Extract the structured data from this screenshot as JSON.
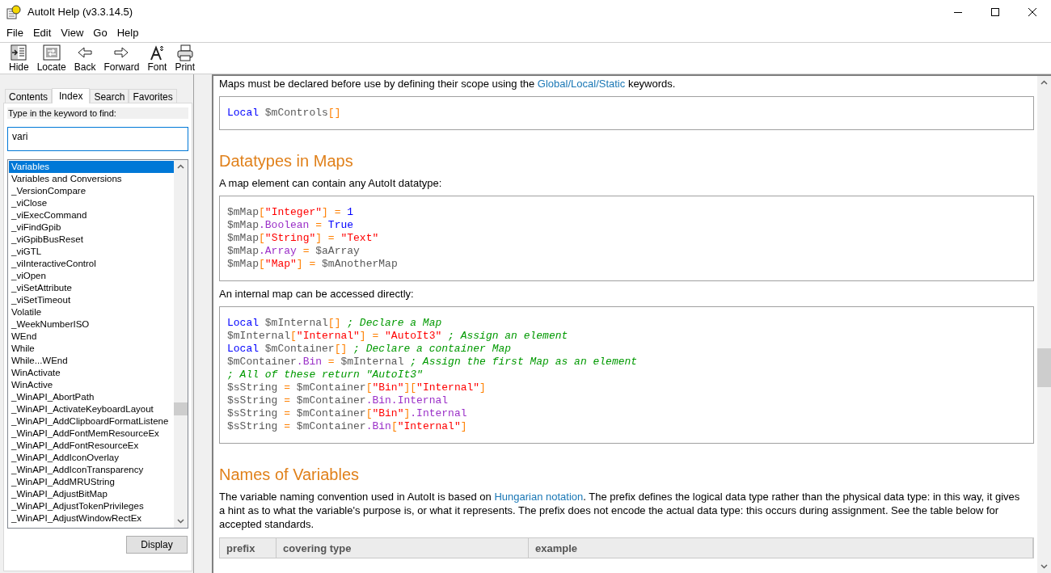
{
  "window": {
    "title": "AutoIt Help (v3.3.14.5)"
  },
  "menu": [
    "File",
    "Edit",
    "View",
    "Go",
    "Help"
  ],
  "toolbar": [
    {
      "label": "Hide",
      "kind": "hide"
    },
    {
      "label": "Locate",
      "kind": "locate"
    },
    {
      "label": "Back",
      "kind": "back"
    },
    {
      "label": "Forward",
      "kind": "forward"
    },
    {
      "label": "Font",
      "kind": "font"
    },
    {
      "label": "Print",
      "kind": "print"
    }
  ],
  "nav": {
    "tabs": [
      {
        "label": "Contents",
        "selected": false
      },
      {
        "label": "Index",
        "selected": true
      },
      {
        "label": "Search",
        "selected": false
      },
      {
        "label": "Favorites",
        "selected": false
      }
    ],
    "prompt": "Type in the keyword to find:",
    "keyword": "vari",
    "items": [
      {
        "label": "Variables",
        "selected": true
      },
      {
        "label": "Variables and Conversions",
        "selected": false
      },
      {
        "label": "_VersionCompare",
        "selected": false
      },
      {
        "label": "_viClose",
        "selected": false
      },
      {
        "label": "_viExecCommand",
        "selected": false
      },
      {
        "label": "_viFindGpib",
        "selected": false
      },
      {
        "label": "_viGpibBusReset",
        "selected": false
      },
      {
        "label": "_viGTL",
        "selected": false
      },
      {
        "label": "_viInteractiveControl",
        "selected": false
      },
      {
        "label": "_viOpen",
        "selected": false
      },
      {
        "label": "_viSetAttribute",
        "selected": false
      },
      {
        "label": "_viSetTimeout",
        "selected": false
      },
      {
        "label": "Volatile",
        "selected": false
      },
      {
        "label": "_WeekNumberISO",
        "selected": false
      },
      {
        "label": "WEnd",
        "selected": false
      },
      {
        "label": "While",
        "selected": false
      },
      {
        "label": "While...WEnd",
        "selected": false
      },
      {
        "label": "WinActivate",
        "selected": false
      },
      {
        "label": "WinActive",
        "selected": false
      },
      {
        "label": "_WinAPI_AbortPath",
        "selected": false
      },
      {
        "label": "_WinAPI_ActivateKeyboardLayout",
        "selected": false
      },
      {
        "label": "_WinAPI_AddClipboardFormatListene",
        "selected": false
      },
      {
        "label": "_WinAPI_AddFontMemResourceEx",
        "selected": false
      },
      {
        "label": "_WinAPI_AddFontResourceEx",
        "selected": false
      },
      {
        "label": "_WinAPI_AddIconOverlay",
        "selected": false
      },
      {
        "label": "_WinAPI_AddIconTransparency",
        "selected": false
      },
      {
        "label": "_WinAPI_AddMRUString",
        "selected": false
      },
      {
        "label": "_WinAPI_AdjustBitMap",
        "selected": false
      },
      {
        "label": "_WinAPI_AdjustTokenPrivileges",
        "selected": false
      },
      {
        "label": "_WinAPI_AdjustWindowRectEx",
        "selected": false
      }
    ],
    "button": "Display"
  },
  "content": [
    {
      "kind": "paragraph",
      "parts": [
        {
          "kind": "text",
          "text": "Maps must be declared before use by defining their scope using the "
        },
        {
          "kind": "link",
          "text": "Global/Local/Static"
        },
        {
          "kind": "text",
          "text": " keywords."
        }
      ]
    },
    {
      "kind": "code",
      "lines": [
        [
          {
            "kind": "keyword",
            "text": "Local"
          },
          {
            "kind": "variable",
            "text": " $mControls"
          },
          {
            "kind": "operator",
            "text": "[]"
          }
        ]
      ]
    },
    {
      "kind": "heading",
      "text": "Datatypes in Maps"
    },
    {
      "kind": "paragraph",
      "parts": [
        {
          "kind": "text",
          "text": "A map element can contain any AutoIt datatype:"
        }
      ]
    },
    {
      "kind": "code",
      "lines": [
        [
          {
            "kind": "variable",
            "text": "$mMap"
          },
          {
            "kind": "operator",
            "text": "["
          },
          {
            "kind": "string",
            "text": "\"Integer\""
          },
          {
            "kind": "operator",
            "text": "] = "
          },
          {
            "kind": "number",
            "text": "1"
          }
        ],
        [
          {
            "kind": "variable",
            "text": "$mMap"
          },
          {
            "kind": "property",
            "text": ".Boolean"
          },
          {
            "kind": "operator",
            "text": " = "
          },
          {
            "kind": "keyword",
            "text": "True"
          }
        ],
        [
          {
            "kind": "variable",
            "text": "$mMap"
          },
          {
            "kind": "operator",
            "text": "["
          },
          {
            "kind": "string",
            "text": "\"String\""
          },
          {
            "kind": "operator",
            "text": "] = "
          },
          {
            "kind": "string",
            "text": "\"Text\""
          }
        ],
        [
          {
            "kind": "variable",
            "text": "$mMap"
          },
          {
            "kind": "property",
            "text": ".Array"
          },
          {
            "kind": "operator",
            "text": " = "
          },
          {
            "kind": "variable",
            "text": "$aArray"
          }
        ],
        [
          {
            "kind": "variable",
            "text": "$mMap"
          },
          {
            "kind": "operator",
            "text": "["
          },
          {
            "kind": "string",
            "text": "\"Map\""
          },
          {
            "kind": "operator",
            "text": "] = "
          },
          {
            "kind": "variable",
            "text": "$mAnotherMap"
          }
        ]
      ]
    },
    {
      "kind": "paragraph",
      "parts": [
        {
          "kind": "text",
          "text": "An internal map can be accessed directly:"
        }
      ]
    },
    {
      "kind": "code",
      "lines": [
        [
          {
            "kind": "keyword",
            "text": "Local"
          },
          {
            "kind": "variable",
            "text": " $mInternal"
          },
          {
            "kind": "operator",
            "text": "[]"
          },
          {
            "kind": "comment",
            "text": " ; Declare a Map"
          }
        ],
        [
          {
            "kind": "variable",
            "text": "$mInternal"
          },
          {
            "kind": "operator",
            "text": "["
          },
          {
            "kind": "string",
            "text": "\"Internal\""
          },
          {
            "kind": "operator",
            "text": "] = "
          },
          {
            "kind": "string",
            "text": "\"AutoIt3\""
          },
          {
            "kind": "comment",
            "text": " ; Assign an element"
          }
        ],
        [
          {
            "kind": "keyword",
            "text": "Local"
          },
          {
            "kind": "variable",
            "text": " $mContainer"
          },
          {
            "kind": "operator",
            "text": "[]"
          },
          {
            "kind": "comment",
            "text": " ; Declare a container Map"
          }
        ],
        [
          {
            "kind": "variable",
            "text": "$mContainer"
          },
          {
            "kind": "property",
            "text": ".Bin"
          },
          {
            "kind": "operator",
            "text": " = "
          },
          {
            "kind": "variable",
            "text": "$mInternal"
          },
          {
            "kind": "comment",
            "text": " ; Assign the first Map as an element"
          }
        ],
        [
          {
            "kind": "comment",
            "text": "; All of these return \"AutoIt3\""
          }
        ],
        [
          {
            "kind": "variable",
            "text": "$sString"
          },
          {
            "kind": "operator",
            "text": " = "
          },
          {
            "kind": "variable",
            "text": "$mContainer"
          },
          {
            "kind": "operator",
            "text": "["
          },
          {
            "kind": "string",
            "text": "\"Bin\""
          },
          {
            "kind": "operator",
            "text": "]["
          },
          {
            "kind": "string",
            "text": "\"Internal\""
          },
          {
            "kind": "operator",
            "text": "]"
          }
        ],
        [
          {
            "kind": "variable",
            "text": "$sString"
          },
          {
            "kind": "operator",
            "text": " = "
          },
          {
            "kind": "variable",
            "text": "$mContainer"
          },
          {
            "kind": "property",
            "text": ".Bin.Internal"
          }
        ],
        [
          {
            "kind": "variable",
            "text": "$sString"
          },
          {
            "kind": "operator",
            "text": " = "
          },
          {
            "kind": "variable",
            "text": "$mContainer"
          },
          {
            "kind": "operator",
            "text": "["
          },
          {
            "kind": "string",
            "text": "\"Bin\""
          },
          {
            "kind": "operator",
            "text": "]"
          },
          {
            "kind": "property",
            "text": ".Internal"
          }
        ],
        [
          {
            "kind": "variable",
            "text": "$sString"
          },
          {
            "kind": "operator",
            "text": " = "
          },
          {
            "kind": "variable",
            "text": "$mContainer"
          },
          {
            "kind": "property",
            "text": ".Bin"
          },
          {
            "kind": "operator",
            "text": "["
          },
          {
            "kind": "string",
            "text": "\"Internal\""
          },
          {
            "kind": "operator",
            "text": "]"
          }
        ]
      ]
    },
    {
      "kind": "heading",
      "text": "Names of Variables"
    },
    {
      "kind": "paragraph",
      "parts": [
        {
          "kind": "text",
          "text": "The variable naming convention used in AutoIt is based on "
        },
        {
          "kind": "link",
          "text": "Hungarian notation"
        },
        {
          "kind": "text",
          "text": ". The prefix defines the logical data type rather than the physical data type: in this way, it gives a hint as to what the variable's purpose is, or what it represents. The prefix does not encode the actual data type: this occurs during assignment. See the table below for accepted standards."
        }
      ]
    },
    {
      "kind": "table",
      "columns": [
        "prefix",
        "covering type",
        "example"
      ]
    }
  ]
}
